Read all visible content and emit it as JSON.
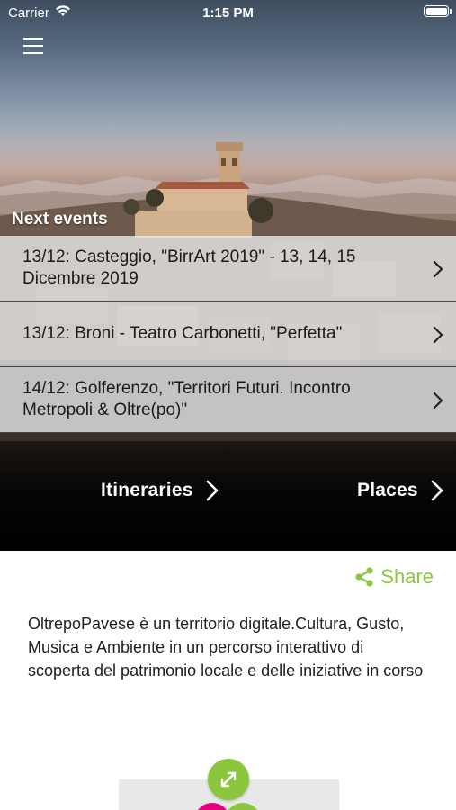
{
  "status_bar": {
    "carrier": "Carrier",
    "time": "1:15 PM"
  },
  "header": {
    "menu_icon": "hamburger-menu-icon"
  },
  "events_section": {
    "title": "Next events",
    "items": [
      {
        "text": "13/12: Casteggio, \"BirrArt 2019\" - 13, 14, 15 Dicembre 2019"
      },
      {
        "text": "13/12: Broni - Teatro Carbonetti, \"Perfetta\""
      },
      {
        "text": "14/12: Golferenzo, \"Territori Futuri. Incontro Metropoli & Oltre(po)\""
      }
    ]
  },
  "nav": {
    "itineraries": "Itineraries",
    "places": "Places"
  },
  "content": {
    "share_label": "Share",
    "description": "OltrepoPavese è un territorio digitale.Cultura, Gusto, Musica e Ambiente in un percorso interattivo di scoperta del patrimonio locale e delle iniziative in corso"
  },
  "colors": {
    "accent_green": "#8cc63f",
    "magenta": "#e6007e"
  }
}
